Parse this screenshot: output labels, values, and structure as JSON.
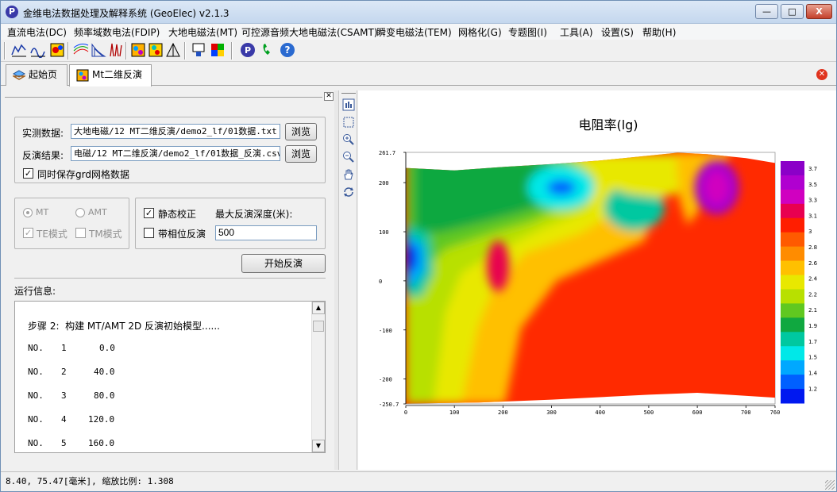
{
  "window": {
    "title": "金维电法数据处理及解释系统 (GeoElec)  v2.1.3",
    "controls": {
      "minimize": "—",
      "maximize": "□",
      "close": "X"
    }
  },
  "menu": [
    "直流电法(DC)",
    "频率域数电法(FDIP)",
    "大地电磁法(MT)",
    "可控源音频大地电磁法(CSAMT)",
    "瞬变电磁法(TEM)",
    "网格化(G)",
    "专题图(I)",
    "工具(A)",
    "设置(S)",
    "帮助(H)"
  ],
  "toolbar_icons": [
    "curve-chart-icon",
    "wave-chart-icon",
    "color-map-icon",
    "contour-icon",
    "section-icon",
    "sounding-icon",
    "inversion-map-icon",
    "inversion-map2-icon",
    "triangle-mesh-icon",
    "export-icon",
    "palette-icon",
    "logo-p-icon",
    "phone-icon",
    "help-icon"
  ],
  "tabs": [
    {
      "label": "起始页",
      "icon": "home-layers-icon"
    },
    {
      "label": "Mt二维反演",
      "icon": "inversion-map-icon"
    }
  ],
  "form": {
    "measured_label": "实测数据:",
    "measured_value": "大地电磁/12 MT二维反演/demo2_lf/01数据.txt",
    "result_label": "反演结果:",
    "result_value": "电磁/12 MT二维反演/demo2_lf/01数据_反演.csv",
    "browse_label": "浏览",
    "save_grid_label": "同时保存grd网格数据",
    "mt_label": "MT",
    "amt_label": "AMT",
    "te_label": "TE模式",
    "tm_label": "TM模式",
    "static_label": "静态校正",
    "phase_label": "带相位反演",
    "depth_label": "最大反演深度(米):",
    "depth_value": "500",
    "start_label": "开始反演"
  },
  "log": {
    "header": "运行信息:",
    "step": "步骤 2:  构建 MT/AMT 2D 反演初始模型......",
    "rows": [
      {
        "label": "NO.",
        "n": "1",
        "v": "0.0"
      },
      {
        "label": "NO.",
        "n": "2",
        "v": "40.0"
      },
      {
        "label": "NO.",
        "n": "3",
        "v": "80.0"
      },
      {
        "label": "NO.",
        "n": "4",
        "v": "120.0"
      },
      {
        "label": "NO.",
        "n": "5",
        "v": "160.0"
      }
    ]
  },
  "side_tools": [
    "layout-icon",
    "fit-icon",
    "zoom-in-icon",
    "zoom-out-icon",
    "hand-icon",
    "refresh-icon"
  ],
  "chart_data": {
    "type": "heatmap",
    "title": "电阻率(lg)",
    "x_ticks": [
      "0",
      "100",
      "200",
      "300",
      "400",
      "500",
      "600",
      "700",
      "760"
    ],
    "y_ticks": [
      "261.7",
      "200",
      "100",
      "0",
      "-100",
      "-200",
      "-250.7"
    ],
    "xlim": [
      0,
      760
    ],
    "ylim": [
      -250.7,
      261.7
    ],
    "colorbar": {
      "min": 1.1,
      "max": 3.8,
      "labels": [
        "3.7",
        "3.5",
        "3.3",
        "3.1",
        "3",
        "2.8",
        "2.6",
        "2.4",
        "2.2",
        "2.1",
        "1.9",
        "1.7",
        "1.5",
        "1.4",
        "1.2"
      ],
      "colors": [
        "#8b00c8",
        "#b000d0",
        "#d000c0",
        "#e80050",
        "#ff1e00",
        "#ff5a00",
        "#ff8c00",
        "#ffc000",
        "#e8e800",
        "#b8e000",
        "#60c820",
        "#10a840",
        "#00c8a0",
        "#00e8e8",
        "#00a8ff",
        "#0060ff",
        "#0018f0"
      ]
    },
    "features": [
      {
        "x": 0,
        "y": 30,
        "value": 1.2
      },
      {
        "x": 190,
        "y": 30,
        "value": 3.3
      },
      {
        "x": 320,
        "y": 190,
        "value": 2.0
      },
      {
        "x": 470,
        "y": 150,
        "value": 1.6
      },
      {
        "x": 640,
        "y": 190,
        "value": 3.7
      }
    ],
    "grid": false
  },
  "status": "8.40, 75.47[毫米], 缩放比例: 1.308"
}
